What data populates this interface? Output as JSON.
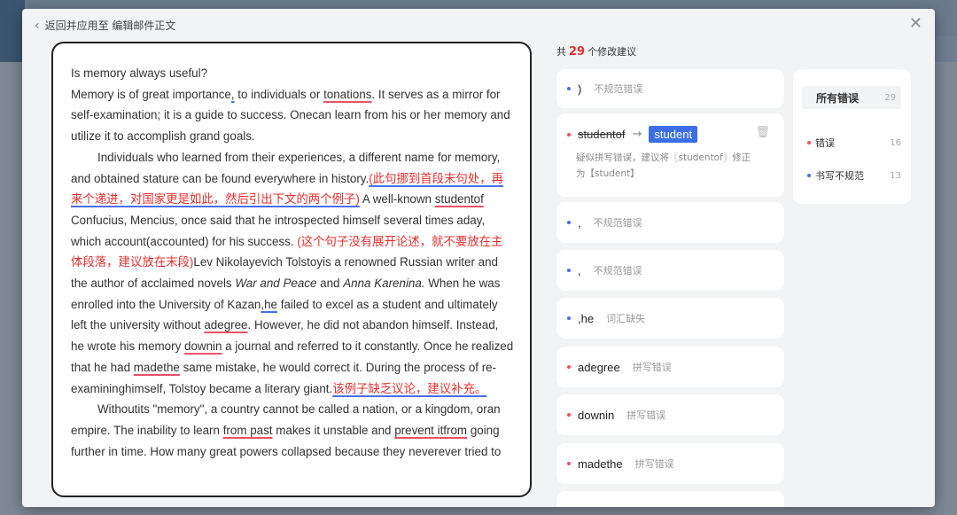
{
  "header": {
    "back_label": "返回并应用至 编辑邮件正文",
    "close_icon": "close-icon"
  },
  "summary": {
    "prefix": "共",
    "count": "29",
    "suffix": "个修改建议"
  },
  "document": {
    "p1": "Is memory always useful?",
    "p2a": "Memory is of great importance",
    "p2b": ",",
    "p2c": " to individuals or ",
    "p2d": "tonations",
    "p2e": ". It serves as a mirror for self-examination; it is a guide to success. Onecan learn from his or her memory and utilize it to accomplish grand goals.",
    "p3a": "Individuals who learned from their experiences, a different name for memory, and obtained stature can be found everywhere in history.",
    "p3b": "(此句挪到首段末句处，再来个递进，对国家更是如此，然后引出下文的两个例子)",
    "p3c": " A well-known ",
    "p3d": "studentof",
    "p3e": " Confucius, Mencius, once said that he introspected himself several times aday, which account(accounted) for his success. ",
    "p3f": "(这个句子没有展开论述，就不要放在主体段落，建议放在末段)",
    "p3g": "Lev Nikolayevich Tolstoyis a renowned Russian writer and the author of acclaimed novels ",
    "p3h": "War and Peace",
    "p3i": " and ",
    "p3j": "Anna Karenina.",
    "p3k": " When he was enrolled into the University of Kazan",
    "p3l": ",he",
    "p3m": " failed to excel as a student and ultimately left the university without ",
    "p3n": "adegree",
    "p3o": ". However, he did not abandon himself. Instead, he wrote his memory ",
    "p3p": "downin",
    "p3q": " a journal and referred to it constantly. Once he realized that he had ",
    "p3r": "madethe",
    "p3s": " same mistake, he would correct it. During the process of re-examininghimself, Tolstoy became a literary giant.",
    "p3t": "该例子缺乏议论，建议补充。",
    "p4a": "Withoutits \"memory\", a country cannot be called a nation, or a kingdom, oran empire. The inability to learn ",
    "p4b": "from past",
    "p4c": " makes it unstable and ",
    "p4d": "prevent itfrom",
    "p4e": " going further in time. How many great powers collapsed because they neverever tried to"
  },
  "suggestions": [
    {
      "word": ")",
      "type": "不规范错误",
      "dot": "blue"
    },
    {
      "original": "studentof",
      "fix": "student",
      "desc": "疑似拼写错误，建议将〖studentof〗修正为【student】",
      "dot": "red",
      "trash_icon": "trash-icon"
    },
    {
      "word": ",",
      "type": "不规范错误",
      "dot": "blue"
    },
    {
      "word": ",",
      "type": "不规范错误",
      "dot": "blue"
    },
    {
      "word": ",he",
      "type": "词汇缺失",
      "dot": "blue"
    },
    {
      "word": "adegree",
      "type": "拼写错误",
      "dot": "red"
    },
    {
      "word": "downin",
      "type": "拼写错误",
      "dot": "red"
    },
    {
      "word": "madethe",
      "type": "拼写错误",
      "dot": "red"
    }
  ],
  "filters": [
    {
      "label": "所有错误",
      "count": "29"
    },
    {
      "label": "错误",
      "count": "16",
      "dot": "red"
    },
    {
      "label": "书写不规范",
      "count": "13",
      "dot": "blue"
    }
  ],
  "colors": {
    "accent": "#3b6ee8",
    "error_red": "#e8302e",
    "underline_red": "#e8526a",
    "underline_blue": "#4a6fe6"
  }
}
